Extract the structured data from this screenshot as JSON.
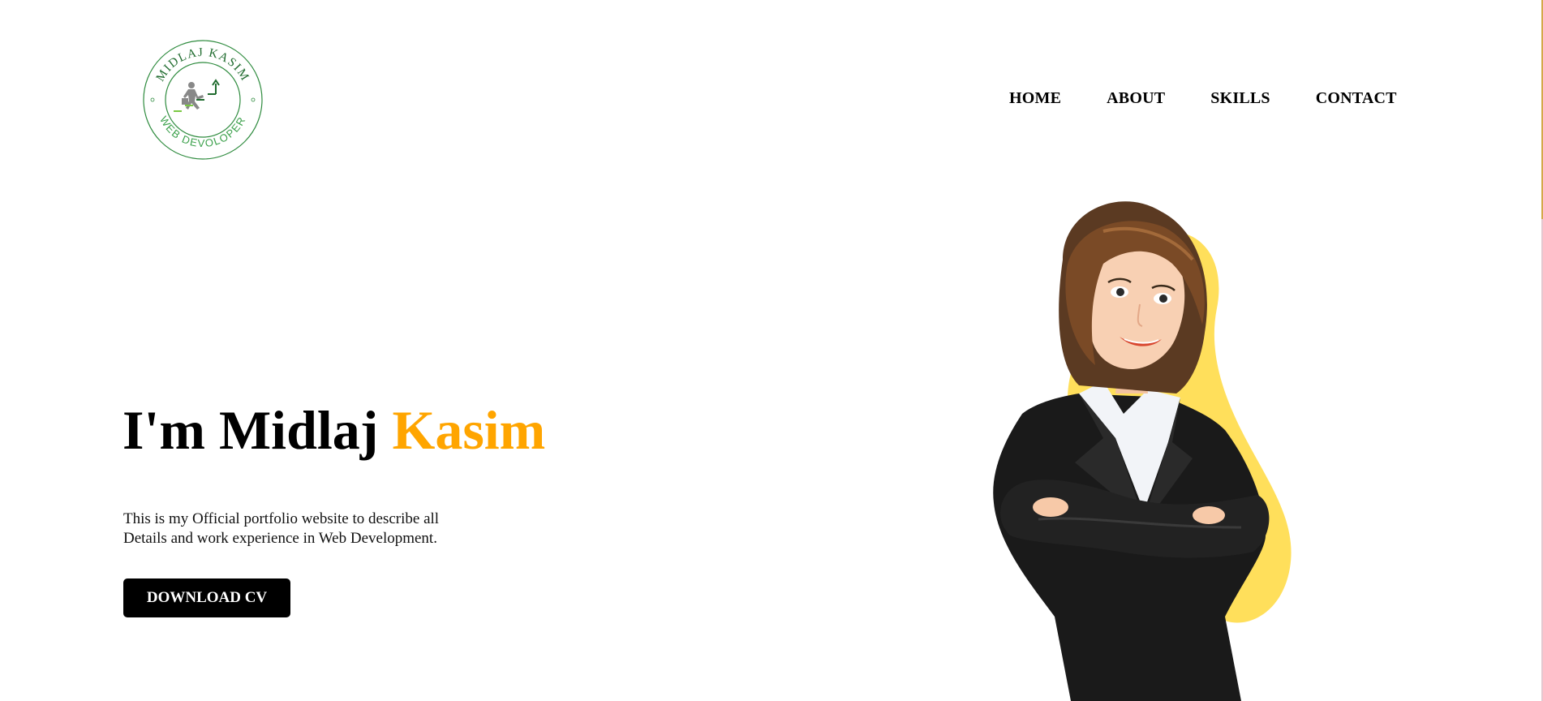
{
  "logo": {
    "top_text": "MIDLAJ KASIM",
    "bottom_text": "WEB DEVOLOPER",
    "icon": "climbing-stairs-person-icon"
  },
  "nav": {
    "items": [
      {
        "label": "HOME"
      },
      {
        "label": "ABOUT"
      },
      {
        "label": "SKILLS"
      },
      {
        "label": "CONTACT"
      }
    ]
  },
  "hero": {
    "title_prefix": "I'm Midlaj ",
    "title_accent": "Kasim",
    "description": "This is my Official portfolio website to describe all Details and work experience in Web Development.",
    "cta_label": "DOWNLOAD CV",
    "illustration": "businesswoman-illustration"
  },
  "colors": {
    "accent": "#ffa500",
    "logo_green": "#2e8b3e",
    "blob_yellow": "#ffdf5b",
    "button_bg": "#000000"
  }
}
